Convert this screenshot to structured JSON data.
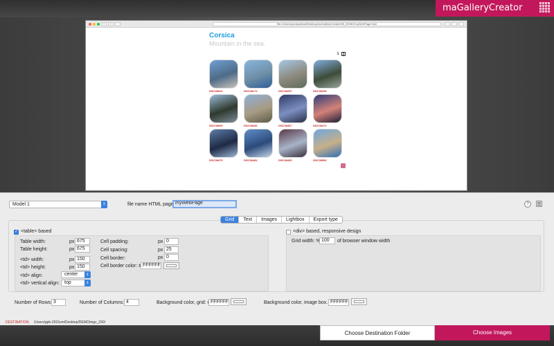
{
  "app": {
    "brand": "maGalleryCreator"
  },
  "browser": {
    "address": "file:///Users/peoepatlout/Desktop/maGalleryCreator000_DEMO/myWebPage.html"
  },
  "preview": {
    "title": "Corsica",
    "subtitle": "Mountain in the sea.",
    "pages": [
      "1",
      "2"
    ],
    "active_page": "2",
    "thumbnails": [
      {
        "caption": "DSC08641",
        "colors": [
          "#6f9fd3",
          "#4e6b88",
          "#c9c4ba"
        ]
      },
      {
        "caption": "DSC08172",
        "colors": [
          "#86b6de",
          "#6f8fa6",
          "#2e5f99"
        ]
      },
      {
        "caption": "DSC08257",
        "colors": [
          "#a5c6e5",
          "#8d8a7e",
          "#5e6a5c"
        ]
      },
      {
        "caption": "DSC08295",
        "colors": [
          "#82aede",
          "#3d4c39",
          "#9aa49b"
        ]
      },
      {
        "caption": "DSC08005",
        "colors": [
          "#9bbbd8",
          "#2e3a2e",
          "#7f8c9a"
        ]
      },
      {
        "caption": "DSC08336",
        "colors": [
          "#8fb0d7",
          "#a89b83",
          "#5b5a48"
        ]
      },
      {
        "caption": "DSC08467",
        "colors": [
          "#313a66",
          "#7c8fc1",
          "#2a2d45"
        ]
      },
      {
        "caption": "DSC08474",
        "colors": [
          "#2e3e7a",
          "#d48278",
          "#1b1e38"
        ]
      },
      {
        "caption": "DSC08479",
        "colors": [
          "#5e7ea8",
          "#1e2a44",
          "#9cb7d6"
        ]
      },
      {
        "caption": "DSC08482",
        "colors": [
          "#5f8fc8",
          "#2c4a7a",
          "#c2d4e6"
        ]
      },
      {
        "caption": "DSC08490",
        "colors": [
          "#5a3847",
          "#a7b4c8",
          "#3a2e3a"
        ]
      },
      {
        "caption": "DSC08506",
        "colors": [
          "#6fa6df",
          "#c7b089",
          "#2d6fb8"
        ]
      }
    ]
  },
  "panel": {
    "model_select": "Model 1",
    "file_name_label": "file name HTML page:",
    "file_name_value": "myWebPage",
    "help_icon": "question-icon",
    "menu_icon": "list-icon",
    "tabs": [
      {
        "label": "Grid",
        "active": true
      },
      {
        "label": "Text",
        "active": false
      },
      {
        "label": "Images",
        "active": false
      },
      {
        "label": "Lightbox",
        "active": false
      },
      {
        "label": "Export type",
        "active": false
      }
    ],
    "table_based": {
      "label": "<table> based",
      "checked": true,
      "table_width_label": "Table width:",
      "table_width_unit": "px",
      "table_width": "675",
      "table_height_label": "Table height:",
      "table_height_unit": "px",
      "table_height": "675",
      "td_width_label": "<td> width:",
      "td_width_unit": "px",
      "td_width": "150",
      "td_height_label": "<td> height:",
      "td_height_unit": "px",
      "td_height": "150",
      "td_align_label": "<td> align:",
      "td_align": "center",
      "td_valign_label": "<td> vertical align:",
      "td_valign": "top",
      "cell_padding_label": "Cell padding:",
      "cell_padding_unit": "px",
      "cell_padding": "0",
      "cell_spacing_label": "Cell spacing:",
      "cell_spacing_unit": "px",
      "cell_spacing": "25",
      "cell_border_label": "Cell border:",
      "cell_border_unit": "px",
      "cell_border": "0",
      "cell_border_color_label": "Cell border color: #",
      "cell_border_color": "FFFFFF"
    },
    "div_based": {
      "label": "<div> based, responsive design",
      "checked": false,
      "grid_width_label": "Grid width: %",
      "grid_width": "100",
      "grid_width_suffix": "of browser window width"
    },
    "rows_label": "Number of Rows:",
    "rows": "3",
    "columns_label": "Number of Columns:",
    "columns": "4",
    "bg_grid_label": "Background color, grid: #",
    "bg_grid": "FFFFFF",
    "bg_image_label": "Background color, image box. #",
    "bg_image": "FFFFFF"
  },
  "footer": {
    "destination_label": "DESTINATION:",
    "destination_path": "/Users/gpb-2915vm/Desktop/DEMO/mgc_230/",
    "choose_destination": "Choose Destination Folder",
    "choose_images": "Choose Images"
  },
  "colors": {
    "accent": "#c2185b",
    "blue": "#3b82e0",
    "title_blue": "#1e9ae0",
    "caption_red": "#c62828"
  }
}
